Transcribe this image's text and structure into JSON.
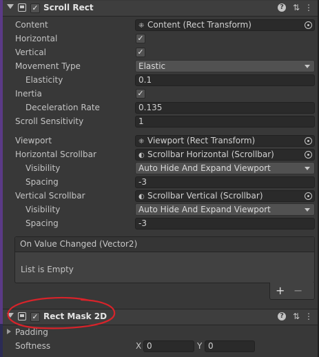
{
  "scroll_rect": {
    "title": "Scroll Rect",
    "enabled": true,
    "content": {
      "label": "Content",
      "value": "Content (Rect Transform)",
      "icon": "rect-transform-icon"
    },
    "horizontal": {
      "label": "Horizontal",
      "checked": true
    },
    "vertical": {
      "label": "Vertical",
      "checked": true
    },
    "movement_type": {
      "label": "Movement Type",
      "value": "Elastic"
    },
    "elasticity": {
      "label": "Elasticity",
      "value": "0.1"
    },
    "inertia": {
      "label": "Inertia",
      "checked": true
    },
    "deceleration_rate": {
      "label": "Deceleration Rate",
      "value": "0.135"
    },
    "scroll_sensitivity": {
      "label": "Scroll Sensitivity",
      "value": "1"
    },
    "viewport": {
      "label": "Viewport",
      "value": "Viewport (Rect Transform)",
      "icon": "rect-transform-icon"
    },
    "horizontal_scrollbar": {
      "label": "Horizontal Scrollbar",
      "value": "Scrollbar Horizontal (Scrollbar)",
      "icon": "scrollbar-icon"
    },
    "h_visibility": {
      "label": "Visibility",
      "value": "Auto Hide And Expand Viewport"
    },
    "h_spacing": {
      "label": "Spacing",
      "value": "-3"
    },
    "vertical_scrollbar": {
      "label": "Vertical Scrollbar",
      "value": "Scrollbar Vertical (Scrollbar)",
      "icon": "scrollbar-icon"
    },
    "v_visibility": {
      "label": "Visibility",
      "value": "Auto Hide And Expand Viewport"
    },
    "v_spacing": {
      "label": "Spacing",
      "value": "-3"
    },
    "on_value_changed": {
      "title": "On Value Changed (Vector2)",
      "empty_text": "List is Empty",
      "add": "+",
      "remove": "−"
    }
  },
  "rect_mask": {
    "title": "Rect Mask 2D",
    "enabled": true,
    "padding": {
      "label": "Padding"
    },
    "softness": {
      "label": "Softness",
      "x_label": "X",
      "x_value": "0",
      "y_label": "Y",
      "y_value": "0"
    }
  },
  "header_buttons": {
    "help": "?",
    "presets": "⇅",
    "menu": "⋮"
  },
  "colors": {
    "annotation": "#d8232a",
    "background": "#383838",
    "accent_edge": "#5b3a86"
  }
}
